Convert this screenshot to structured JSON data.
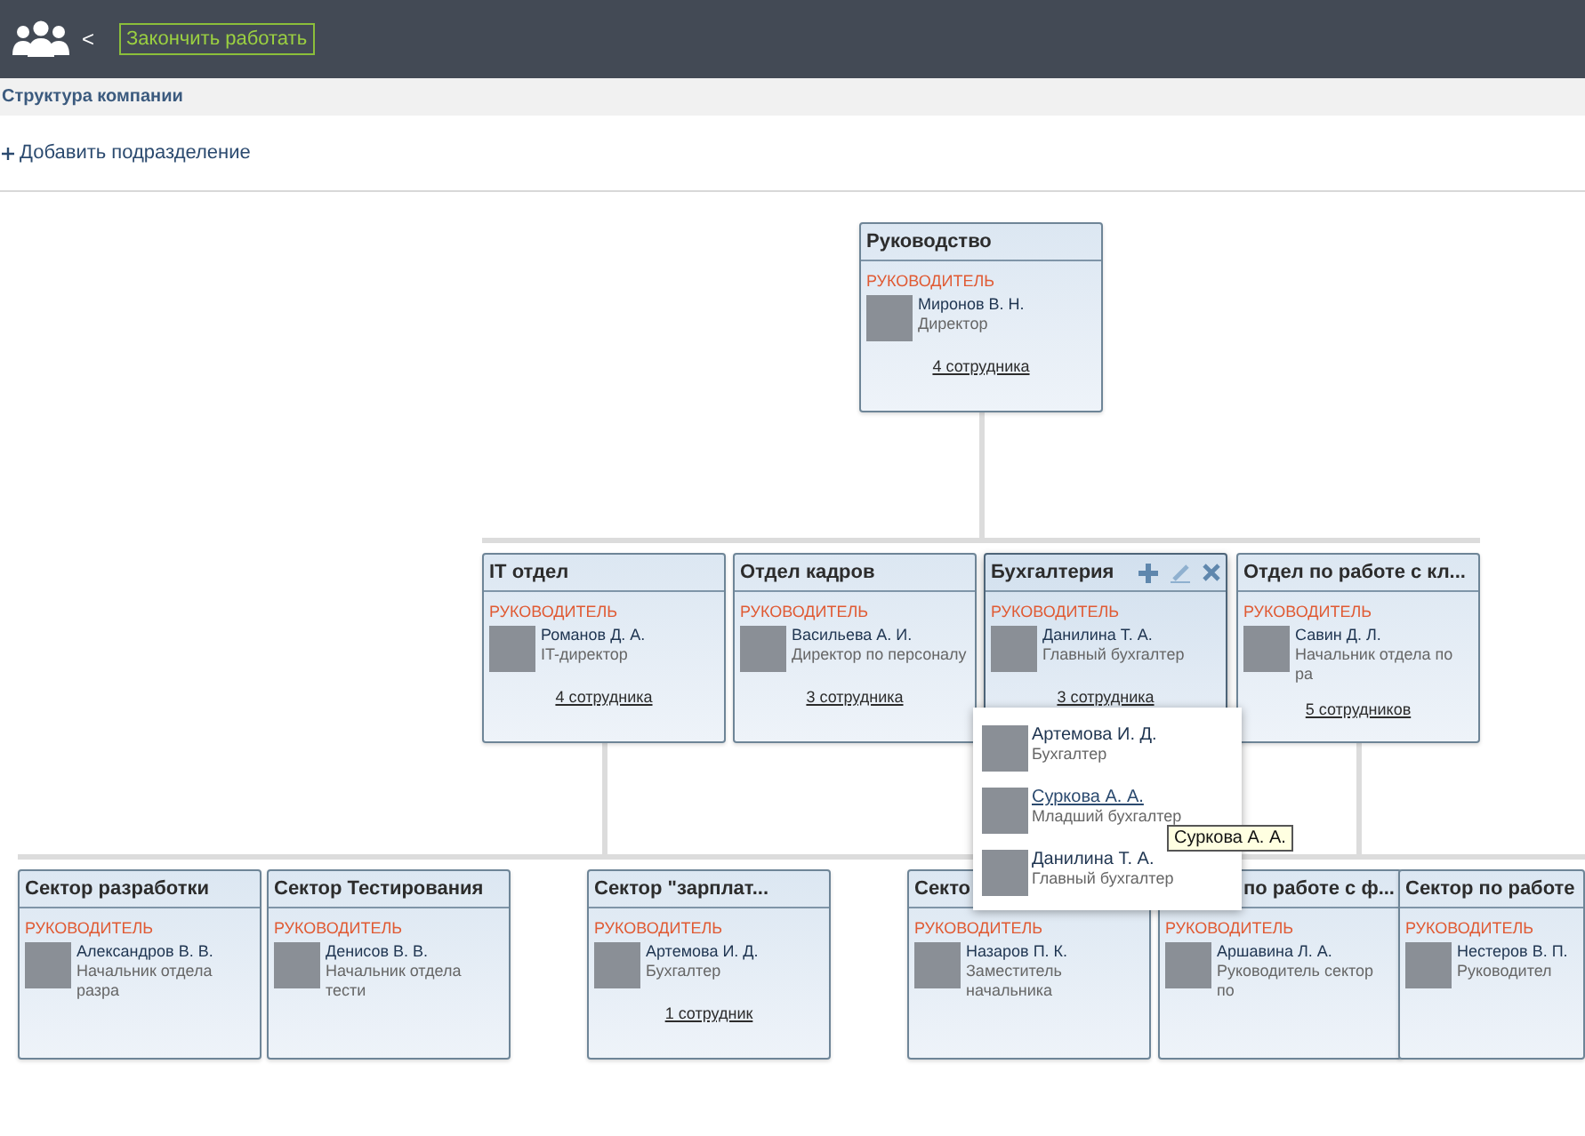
{
  "header": {
    "back": "<",
    "finish_button": "Закончить работать"
  },
  "breadcrumb": "Структура компании",
  "add_link": "Добавить подразделение",
  "departments": {
    "title": "Руководство",
    "head_label": "РУКОВОДИТЕЛЬ",
    "head_name": "Миронов В. Н.",
    "head_position": "Директор",
    "count": "4 сотрудника",
    "show_actions": false,
    "title_covered": false,
    "children": [
      {
        "title": "IT отдел",
        "head_label": "РУКОВОДИТЕЛЬ",
        "head_name": "Романов Д. А.",
        "head_position": "IT-директор",
        "count": "4 сотрудника",
        "show_actions": false,
        "title_covered": false,
        "children": [
          {
            "title": "Сектор разработки",
            "head_label": "РУКОВОДИТЕЛЬ",
            "head_name": "Александров В. В.",
            "head_position": "Начальник отдела разра",
            "show_actions": false,
            "title_covered": false
          },
          {
            "title": "Сектор Тестирования",
            "head_label": "РУКОВОДИТЕЛЬ",
            "head_name": "Денисов В. В.",
            "head_position": "Начальник отдела тести",
            "show_actions": false,
            "title_covered": false
          }
        ]
      },
      {
        "title": "Отдел кадров",
        "head_label": "РУКОВОДИТЕЛЬ",
        "head_name": "Васильева А. И.",
        "head_position": "Директор по персоналу",
        "count": "3 сотрудника",
        "show_actions": false,
        "title_covered": false
      },
      {
        "title": "Бухгалтерия",
        "head_label": "РУКОВОДИТЕЛЬ",
        "head_name": "Данилина Т. А.",
        "head_position": "Главный бухгалтер",
        "count": "3 сотрудника",
        "show_actions": true,
        "title_covered": false,
        "children": [
          {
            "title": "Сектор \"зарплат...",
            "head_label": "РУКОВОДИТЕЛЬ",
            "head_name": "Артемова И. Д.",
            "head_position": "Бухгалтер",
            "count": "1 сотрудник",
            "show_actions": false,
            "title_covered": false
          }
        ]
      },
      {
        "title": "Отдел по работе с кл...",
        "head_label": "РУКОВОДИТЕЛЬ",
        "head_name": "Савин Д. Л.",
        "head_position": "Начальник отдела по ра",
        "count": "5 сотрудников",
        "show_actions": false,
        "title_covered": false,
        "children": [
          {
            "title": "Секто",
            "head_label": "РУКОВОДИТЕЛЬ",
            "head_name": "Назаров П. К.",
            "head_position": "Заместитель начальника",
            "show_actions": false,
            "title_covered": false
          },
          {
            "title": "по работе с ф...",
            "head_label": "РУКОВОДИТЕЛЬ",
            "head_name": "Аршавина Л. А.",
            "head_position": "Руководитель сектор по",
            "show_actions": false,
            "title_covered": true
          },
          {
            "title": "Сектор по работе",
            "head_label": "РУКОВОДИТЕЛЬ",
            "head_name": "Нестеров В. П.",
            "head_position": "Руководител",
            "show_actions": false,
            "title_covered": false
          }
        ]
      }
    ]
  },
  "employees_popup": [
    {
      "name": "Артемова И. Д.",
      "position": "Бухгалтер",
      "hovered": false
    },
    {
      "name": "Суркова А. А.",
      "position": "Младший бухгалтер",
      "hovered": true
    },
    {
      "name": "Данилина Т. А.",
      "position": "Главный бухгалтер",
      "hovered": false
    }
  ],
  "tooltip": "Суркова А. А."
}
